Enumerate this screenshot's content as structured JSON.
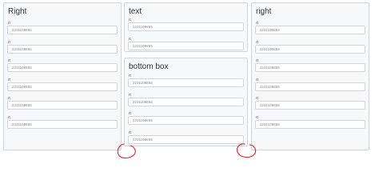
{
  "panels": {
    "left": {
      "title": "Right",
      "fields": [
        {
          "label": "rt",
          "value": "2231108855"
        },
        {
          "label": "rt",
          "value": "2231108855"
        },
        {
          "label": "rt",
          "value": "2231108855"
        },
        {
          "label": "rt",
          "value": "2231108855"
        },
        {
          "label": "rt",
          "value": "2231108855"
        },
        {
          "label": "rt",
          "value": "2231108855"
        }
      ]
    },
    "top": {
      "title": "text",
      "fields": [
        {
          "label": "rt",
          "value": "2231108855"
        },
        {
          "label": "rt",
          "value": "2231108855"
        }
      ]
    },
    "bottom": {
      "title": "bottom box",
      "fields": [
        {
          "label": "rt",
          "value": "2231108855"
        },
        {
          "label": "rt",
          "value": "2231108855"
        },
        {
          "label": "rt",
          "value": "2231108855"
        },
        {
          "label": "rt",
          "value": "2231108855"
        }
      ]
    },
    "right": {
      "title": "right",
      "fields": [
        {
          "label": "rt",
          "value": "2231108855"
        },
        {
          "label": "rt",
          "value": "2231108855"
        },
        {
          "label": "rt",
          "value": "2231108855"
        },
        {
          "label": "rt",
          "value": "2231108855"
        },
        {
          "label": "rt",
          "value": "2231108855"
        },
        {
          "label": "rt",
          "value": "2231108855"
        }
      ]
    }
  },
  "colors": {
    "panel_border": "#c9d6e6",
    "panel_bg": "#f7f8fa",
    "annotation": "#e0242b"
  }
}
